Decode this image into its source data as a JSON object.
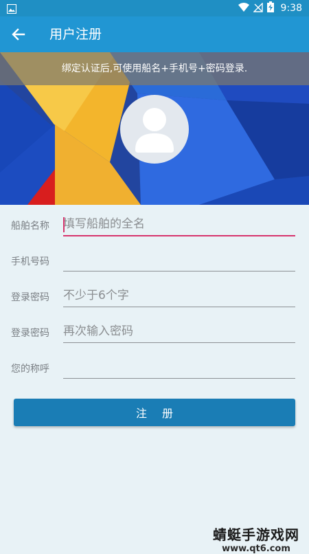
{
  "status_bar": {
    "time": "9:38",
    "icons": [
      "gallery-icon",
      "wifi-icon",
      "no-signal-icon",
      "battery-charging-icon"
    ]
  },
  "app_bar": {
    "title": "用户注册",
    "back_icon": "arrow-left-icon"
  },
  "notice": {
    "text": "绑定认证后,可使用船名+手机号+密码登录."
  },
  "avatar": {
    "icon": "user-avatar-icon"
  },
  "form": {
    "fields": [
      {
        "label": "船舶名称",
        "placeholder": "填写船舶的全名",
        "value": ""
      },
      {
        "label": "手机号码",
        "placeholder": "",
        "value": ""
      },
      {
        "label": "登录密码",
        "placeholder": "不少于6个字",
        "value": ""
      },
      {
        "label": "登录密码",
        "placeholder": "再次输入密码",
        "value": ""
      },
      {
        "label": "您的称呼",
        "placeholder": "",
        "value": ""
      }
    ],
    "submit_label": "注册"
  },
  "watermark": {
    "line1": "蜻蜓手游戏网",
    "line2": "www.qt6.com"
  },
  "colors": {
    "app_bar": "#2196d3",
    "status_bar": "#1f8fc4",
    "button": "#1a7db5",
    "active_underline": "#d6336c",
    "background": "#e8f2f6"
  }
}
